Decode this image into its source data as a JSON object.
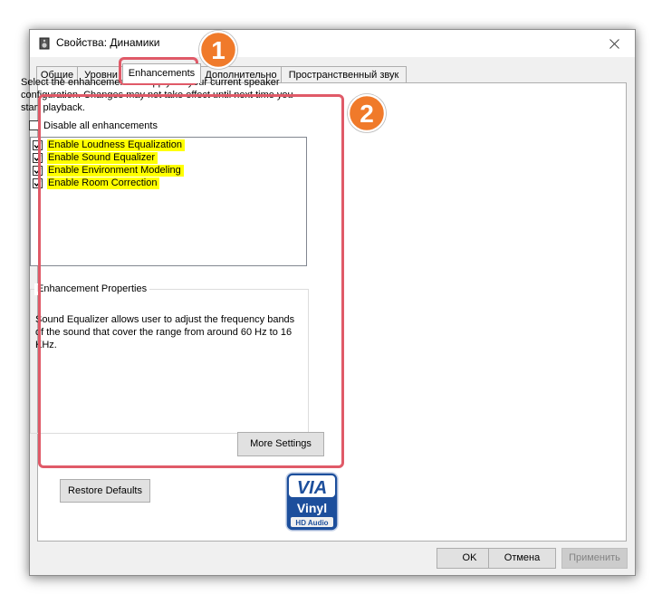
{
  "window": {
    "title": "Свойства: Динамики"
  },
  "tabs": [
    {
      "label": "Общие"
    },
    {
      "label": "Уровни"
    },
    {
      "label": "Enhancements"
    },
    {
      "label": "Дополнительно"
    },
    {
      "label": "Пространственный звук"
    }
  ],
  "enhancements": {
    "description": "Select the enhancements to apply for your current speaker configuration. Changes may not take effect until next time you start playback.",
    "disable_all": {
      "label": "Disable all enhancements",
      "checked": false
    },
    "items": [
      {
        "label": "Enable Loudness Equalization",
        "checked": true
      },
      {
        "label": "Enable Sound Equalizer",
        "checked": true
      },
      {
        "label": "Enable Environment Modeling",
        "checked": true
      },
      {
        "label": "Enable Room Correction",
        "checked": true
      }
    ],
    "properties": {
      "title": "Enhancement Properties",
      "text": "Sound Equalizer allows user to adjust the frequency bands of the sound that cover the range from around 60 Hz to 16 KHz.",
      "more_settings": "More Settings"
    },
    "restore_defaults": "Restore Defaults"
  },
  "logo": {
    "brand": "VIA",
    "line1": "Vinyl",
    "line2": "HD Audio"
  },
  "footer": {
    "ok": "OK",
    "cancel": "Отмена",
    "apply": "Применить"
  },
  "annotations": {
    "badge1": "1",
    "badge2": "2"
  },
  "colors": {
    "highlight": "#ffff00",
    "annotation_border": "#e05a68",
    "badge": "#f07a2a"
  }
}
